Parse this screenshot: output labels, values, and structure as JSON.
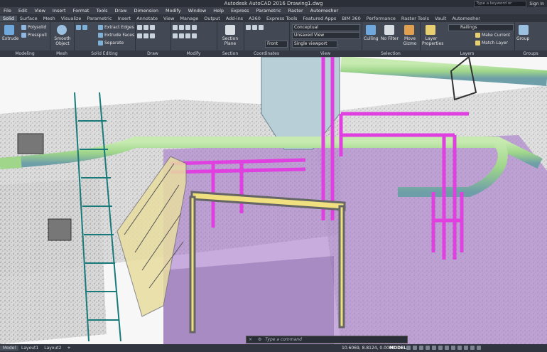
{
  "title": "Autodesk AutoCAD 2016    Drawing1.dwg",
  "search_placeholder": "Type a keyword or phrase",
  "signin": "Sign In",
  "menu": [
    "File",
    "Edit",
    "View",
    "Insert",
    "Format",
    "Tools",
    "Draw",
    "Dimension",
    "Modify",
    "Window",
    "Help",
    "Express",
    "Parametric",
    "Raster",
    "Automesher"
  ],
  "tabs": [
    "Solid",
    "Surface",
    "Mesh",
    "Visualize",
    "Parametric",
    "Insert",
    "Annotate",
    "View",
    "Manage",
    "Output",
    "Add-ins",
    "A360",
    "Express Tools",
    "Featured Apps",
    "BIM 360",
    "Performance",
    "Raster Tools",
    "Vault",
    "Automesher"
  ],
  "active_tab": "Solid",
  "ribbon": {
    "extrude": "Extrude",
    "polysolid": "Polysolid",
    "presspull": "Presspull",
    "smooth_object": "Smooth Object",
    "extract_edges": "Extract Edges",
    "extrude_faces": "Extrude Faces",
    "separate": "Separate",
    "section_plane": "Section Plane",
    "visual_style": "Conceptual",
    "unsaved_view": "Unsaved View",
    "front": "Front",
    "single_viewport": "Single viewport",
    "culling": "Culling",
    "no_filter": "No Filter",
    "move_gizmo": "Move Gizmo",
    "layer_properties": "Layer Properties",
    "layer_name": "Railings",
    "make_current": "Make Current",
    "match_layer": "Match Layer",
    "group": "Group",
    "panels": [
      "Modeling",
      "Mesh",
      "Solid Editing",
      "Draw",
      "Modify",
      "Section",
      "Coordinates",
      "View",
      "Selection",
      "Layers",
      "Groups"
    ]
  },
  "command_placeholder": "Type a command",
  "layout_tabs": [
    "Model",
    "Layout1",
    "Layout2"
  ],
  "coordinates": "10.6069, 8.8124, 0.0000",
  "space": "MODEL",
  "colors": {
    "pipe": "#9fd68a",
    "magenta": "#e040e0",
    "purple_plane": "#a070c8",
    "yellow": "#f0e080",
    "ribbon": "#424854"
  }
}
